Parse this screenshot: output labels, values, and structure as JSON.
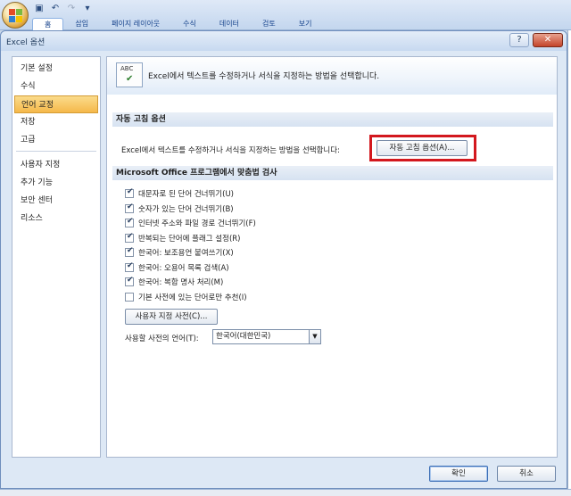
{
  "ribbon": {
    "tabs": [
      "홈",
      "삽입",
      "페이지 레이아웃",
      "수식",
      "데이터",
      "검토",
      "보기"
    ],
    "active_tab": 0
  },
  "dialog": {
    "title": "Excel 옵션",
    "help_label": "?",
    "close_label": "✕"
  },
  "nav": {
    "groups": [
      [
        "기본 설정",
        "수식",
        "언어 교정",
        "저장",
        "고급"
      ],
      [
        "사용자 지정",
        "추가 기능",
        "보안 센터",
        "리소스"
      ]
    ],
    "active": "언어 교정"
  },
  "panel": {
    "header_text": "Excel에서 텍스트를 수정하거나 서식을 지정하는 방법을 선택합니다.",
    "autocorrect": {
      "section_title": "자동 고침 옵션",
      "description": "Excel에서 텍스트를 수정하거나 서식을 지정하는 방법을 선택합니다:",
      "button_label": "자동 고침 옵션(A)..."
    },
    "spelling": {
      "section_title": "Microsoft Office 프로그램에서 맞춤법 검사",
      "checks": [
        {
          "label": "대문자로 된 단어 건너뛰기(U)",
          "checked": true
        },
        {
          "label": "숫자가 있는 단어 건너뛰기(B)",
          "checked": true
        },
        {
          "label": "인터넷 주소와 파일 경로 건너뛰기(F)",
          "checked": true
        },
        {
          "label": "반복되는 단어에 플래그 설정(R)",
          "checked": true
        },
        {
          "label": "한국어: 보조용언 붙여쓰기(X)",
          "checked": true
        },
        {
          "label": "한국어: 오용어 목록 검색(A)",
          "checked": true
        },
        {
          "label": "한국어: 복합 명사 처리(M)",
          "checked": true
        },
        {
          "label": "기본 사전에 있는 단어로만 추천(I)",
          "checked": false
        }
      ],
      "custom_dict_label": "사용자 지정 사전(C)...",
      "lang_label": "사용할 사전의 언어(T):",
      "lang_value": "한국어(대한민국)"
    }
  },
  "footer": {
    "ok_label": "확인",
    "cancel_label": "취소"
  },
  "colors": {
    "highlight_border": "#d3181e",
    "active_nav": "#f5b84a"
  }
}
